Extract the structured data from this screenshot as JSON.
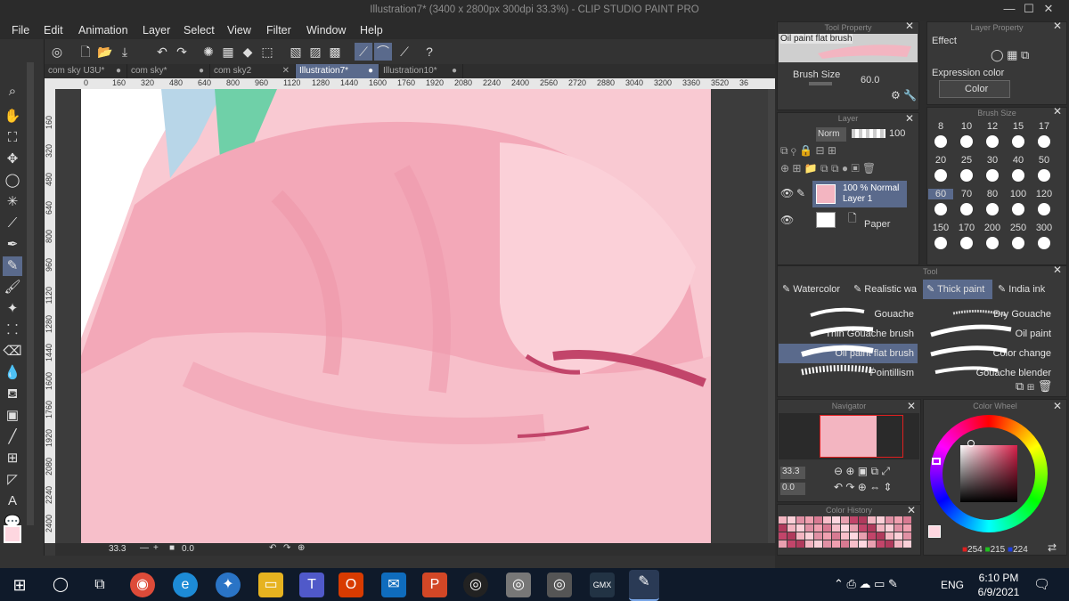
{
  "window": {
    "title": "Illustration7* (3400 x 2800px 300dpi 33.3%)  - CLIP STUDIO PAINT PRO"
  },
  "menu": [
    "File",
    "Edit",
    "Animation",
    "Layer",
    "Select",
    "View",
    "Filter",
    "Window",
    "Help"
  ],
  "tabs": [
    "com sky U3U*",
    "com sky*",
    "com sky2",
    "Illustration7*",
    "Illustration10*"
  ],
  "ruler": {
    "h": [
      "0",
      "160",
      "320",
      "480",
      "640",
      "800",
      "960",
      "1120",
      "1280",
      "1440",
      "1600",
      "1760",
      "1920",
      "2080",
      "2240",
      "2400",
      "2560",
      "2720",
      "2880",
      "3040",
      "3200",
      "3360",
      "3520",
      "36"
    ],
    "v": [
      "160",
      "320",
      "480",
      "640",
      "800",
      "960",
      "1120",
      "1280",
      "1440",
      "1600",
      "1760",
      "1920",
      "2080",
      "2240",
      "2400"
    ]
  },
  "status": {
    "zoom": "33.3",
    "angle": "0.0"
  },
  "tool_property": {
    "title": "Tool Property",
    "brush_name": "Oil paint flat brush",
    "size_label": "Brush Size",
    "size_value": "60.0"
  },
  "layer_property": {
    "title": "Layer Property",
    "effect_label": "Effect",
    "expression_label": "Expression color",
    "expression_value": "Color"
  },
  "layer_panel": {
    "title": "Layer",
    "blend_mode": "Norm",
    "opacity": "100",
    "layers": [
      {
        "line1": "100 % Normal",
        "line2": "Layer 1"
      },
      {
        "line1": "Paper",
        "line2": ""
      }
    ]
  },
  "brush_size_panel": {
    "title": "Brush Size",
    "sizes": [
      "8",
      "10",
      "12",
      "15",
      "17",
      "20",
      "25",
      "30",
      "40",
      "50",
      "60",
      "70",
      "80",
      "100",
      "120",
      "150",
      "170",
      "200",
      "250",
      "300"
    ]
  },
  "tool_panel": {
    "title": "Tool",
    "tabs": [
      "Watercolor",
      "Realistic wa",
      "Thick paint",
      "India ink"
    ],
    "brushes_left": [
      "Gouache",
      "Thin Gouache brush",
      "Oil paint flat brush",
      "Pointillism"
    ],
    "brushes_right": [
      "Dry Gouache",
      "Oil paint",
      "Color change",
      "Gouache blender"
    ]
  },
  "navigator": {
    "title": "Navigator",
    "zoom": "33.3",
    "angle": "0.0"
  },
  "color_history": {
    "title": "Color History"
  },
  "color_wheel": {
    "title": "Color Wheel",
    "r": "254",
    "g": "215",
    "b": "224"
  },
  "taskbar": {
    "lang": "ENG",
    "time": "6:10 PM",
    "date": "6/9/2021"
  },
  "colors": {
    "accent": "#5a6a8c",
    "current_color": "#fed7e0"
  }
}
